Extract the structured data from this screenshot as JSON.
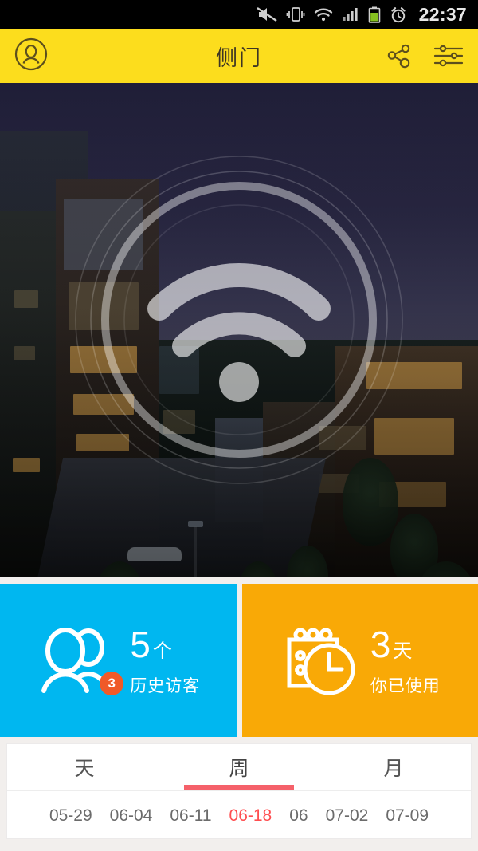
{
  "statusbar": {
    "icons": [
      "mute-icon",
      "vibrate-icon",
      "wifi-icon",
      "signal-icon",
      "battery-icon",
      "alarm-icon"
    ],
    "time": "22:37"
  },
  "titlebar": {
    "profile_icon": "person-circle-icon",
    "title": "侧门",
    "share_icon": "share-icon",
    "settings_icon": "sliders-icon",
    "background_color": "#fcdd1d",
    "text_color": "#3d3524"
  },
  "hero": {
    "overlay_icon": "wifi-signal-icon",
    "description": "night cityscape photo"
  },
  "cards": [
    {
      "icon": "people-icon",
      "badge": "3",
      "number": "5",
      "unit": "个",
      "label": "历史访客",
      "color": "#00b7f0"
    },
    {
      "icon": "calendar-clock-icon",
      "badge": null,
      "number": "3",
      "unit": "天",
      "label": "你已使用",
      "color": "#f9a906"
    }
  ],
  "panel": {
    "tabs": [
      {
        "label": "天",
        "active": false
      },
      {
        "label": "周",
        "active": true
      },
      {
        "label": "月",
        "active": false
      }
    ],
    "active_color": "#f5616a",
    "dates": [
      {
        "label": "05-29",
        "active": false
      },
      {
        "label": "06-04",
        "active": false
      },
      {
        "label": "06-11",
        "active": false
      },
      {
        "label": "06-18",
        "active": true
      },
      {
        "label": "06",
        "active": false
      },
      {
        "label": "07-02",
        "active": false
      },
      {
        "label": "07-09",
        "active": false
      }
    ]
  }
}
